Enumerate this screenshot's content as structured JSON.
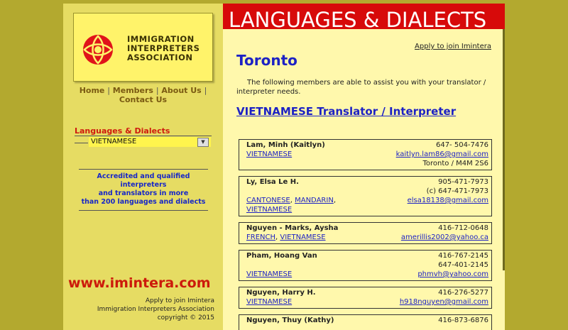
{
  "logo": {
    "line1": "IMMIGRATION",
    "line2": "INTERPRETERS",
    "line3": "ASSOCIATION"
  },
  "nav": {
    "home": "Home",
    "members": "Members",
    "about": "About Us",
    "contact": "Contact Us",
    "sep": "|"
  },
  "language_select": {
    "label": "Languages & Dialects",
    "value": "VIETNAMESE"
  },
  "accredited": {
    "line1": "Accredited and qualified",
    "line2": "interpreters",
    "line3": "and translators in more",
    "line4": "than 200 languages and dialects"
  },
  "site_url": "www.imintera.com",
  "footer": {
    "line1": "Apply to join Imintera",
    "line2": "Immigration Interpreters Association",
    "line3": "copyright © 2015"
  },
  "banner": "LANGUAGES & DIALECTS",
  "apply_link": "Apply to join Imintera",
  "city": "Toronto",
  "intro": "The following members are able to assist you with your translator / interpreter needs.",
  "section_title": "VIETNAMESE Translator / Interpreter",
  "members": [
    {
      "name": "Lam, Minh (Kaitlyn)",
      "phone1": "647- 504-7476",
      "email": "kaitlyn.lam86@gmail.com",
      "location": "Toronto / M4M 2S6",
      "lang1": "VIETNAMESE"
    },
    {
      "name": "Ly, Elsa Le H.",
      "phone1": "905-471-7973",
      "phone2": "(c) 647-471-7973",
      "email": "elsa18138@gmail.com",
      "lang1": "CANTONESE",
      "lang2": "MANDARIN",
      "lang3": "VIETNAMESE"
    },
    {
      "name": "Nguyen - Marks, Aysha",
      "phone1": "416-712-0648",
      "email": "amerillis2002@yahoo.ca",
      "lang1": "FRENCH",
      "lang2": "VIETNAMESE"
    },
    {
      "name": "Pham, Hoang Van",
      "phone1": "416-767-2145",
      "phone2": "647-401-2145",
      "email": "phmvh@yahoo.com",
      "lang1": "VIETNAMESE"
    },
    {
      "name": "Nguyen, Harry H.",
      "phone1": "416-276-5277",
      "email": "h918nguyen@gmail.com",
      "lang1": "VIETNAMESE"
    },
    {
      "name": "Nguyen, Thuy (Kathy)",
      "phone1": "416-873-6876"
    }
  ]
}
